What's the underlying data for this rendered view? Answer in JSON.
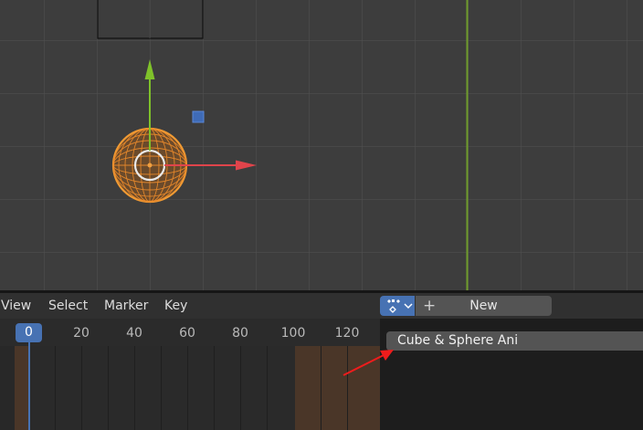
{
  "dopesheet": {
    "menu": [
      {
        "label": "View"
      },
      {
        "label": "Select"
      },
      {
        "label": "Marker"
      },
      {
        "label": "Key"
      }
    ],
    "new_action_label": "New",
    "action_name": "Cube & Sphere Ani"
  },
  "timeline": {
    "current_frame": "0",
    "frame_labels": [
      "20",
      "40",
      "60",
      "80",
      "100",
      "120"
    ]
  },
  "colors": {
    "selection_orange": "#e8892b",
    "x_axis_red": "#e0444b",
    "y_axis_green": "#7fc22a",
    "active_blue": "#4772b3",
    "annotation_red": "#ee1c1c"
  }
}
